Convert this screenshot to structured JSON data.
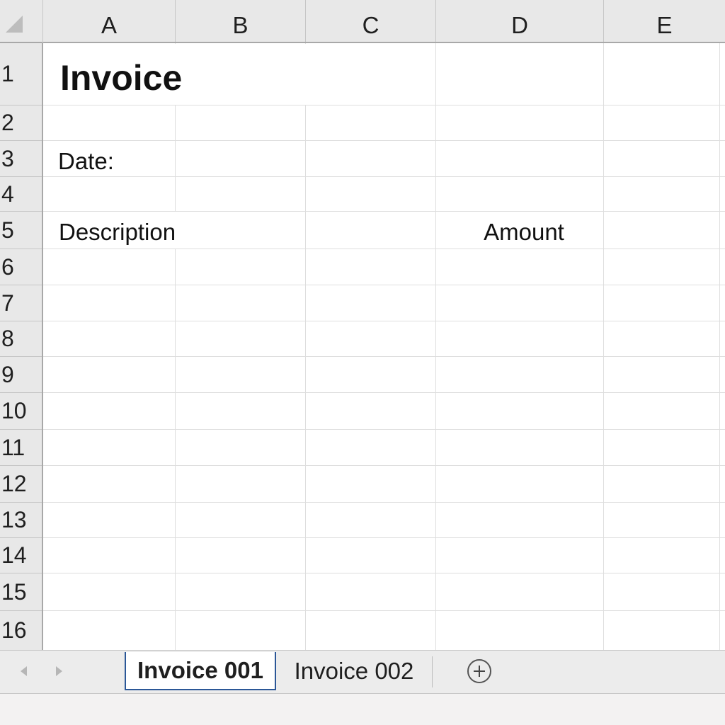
{
  "columns": [
    "A",
    "B",
    "C",
    "D",
    "E"
  ],
  "rows": [
    "1",
    "2",
    "3",
    "4",
    "5",
    "6",
    "7",
    "8",
    "9",
    "10",
    "11",
    "12",
    "13",
    "14",
    "15",
    "16"
  ],
  "cells": {
    "a1": "Invoice",
    "a3": "Date:",
    "a5": "Description",
    "d5": "Amount"
  },
  "sheets": [
    {
      "label": "Invoice 001",
      "active": true
    },
    {
      "label": "Invoice 002",
      "active": false
    }
  ],
  "icons": {
    "select_all": "select-all-triangle",
    "prev": "chevron-left",
    "next": "chevron-right",
    "add_sheet": "plus-circle"
  }
}
